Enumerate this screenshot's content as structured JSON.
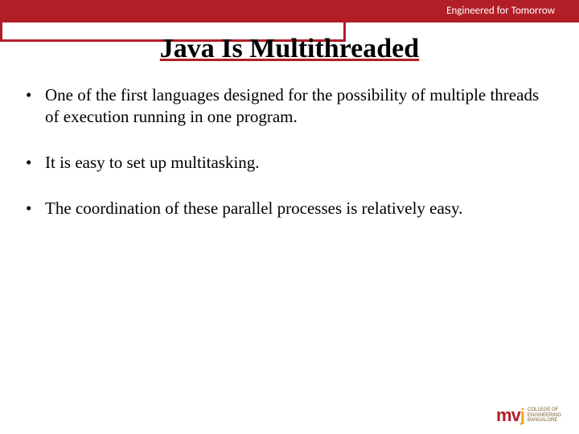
{
  "header": {
    "tagline": "Engineered for Tomorrow"
  },
  "slide": {
    "title": "Java Is Multithreaded",
    "bullets": [
      "One of the first languages designed for the possibility of multiple threads of execution running in one program.",
      "It is easy to set up multitasking.",
      "The coordination of these parallel processes is relatively easy."
    ]
  },
  "footer": {
    "logo_mark_a": "m",
    "logo_mark_b": "v",
    "logo_mark_c": "j",
    "logo_text_1": "COLLEGE OF",
    "logo_text_2": "ENGINEERING",
    "logo_text_3": "BANGALORE"
  }
}
